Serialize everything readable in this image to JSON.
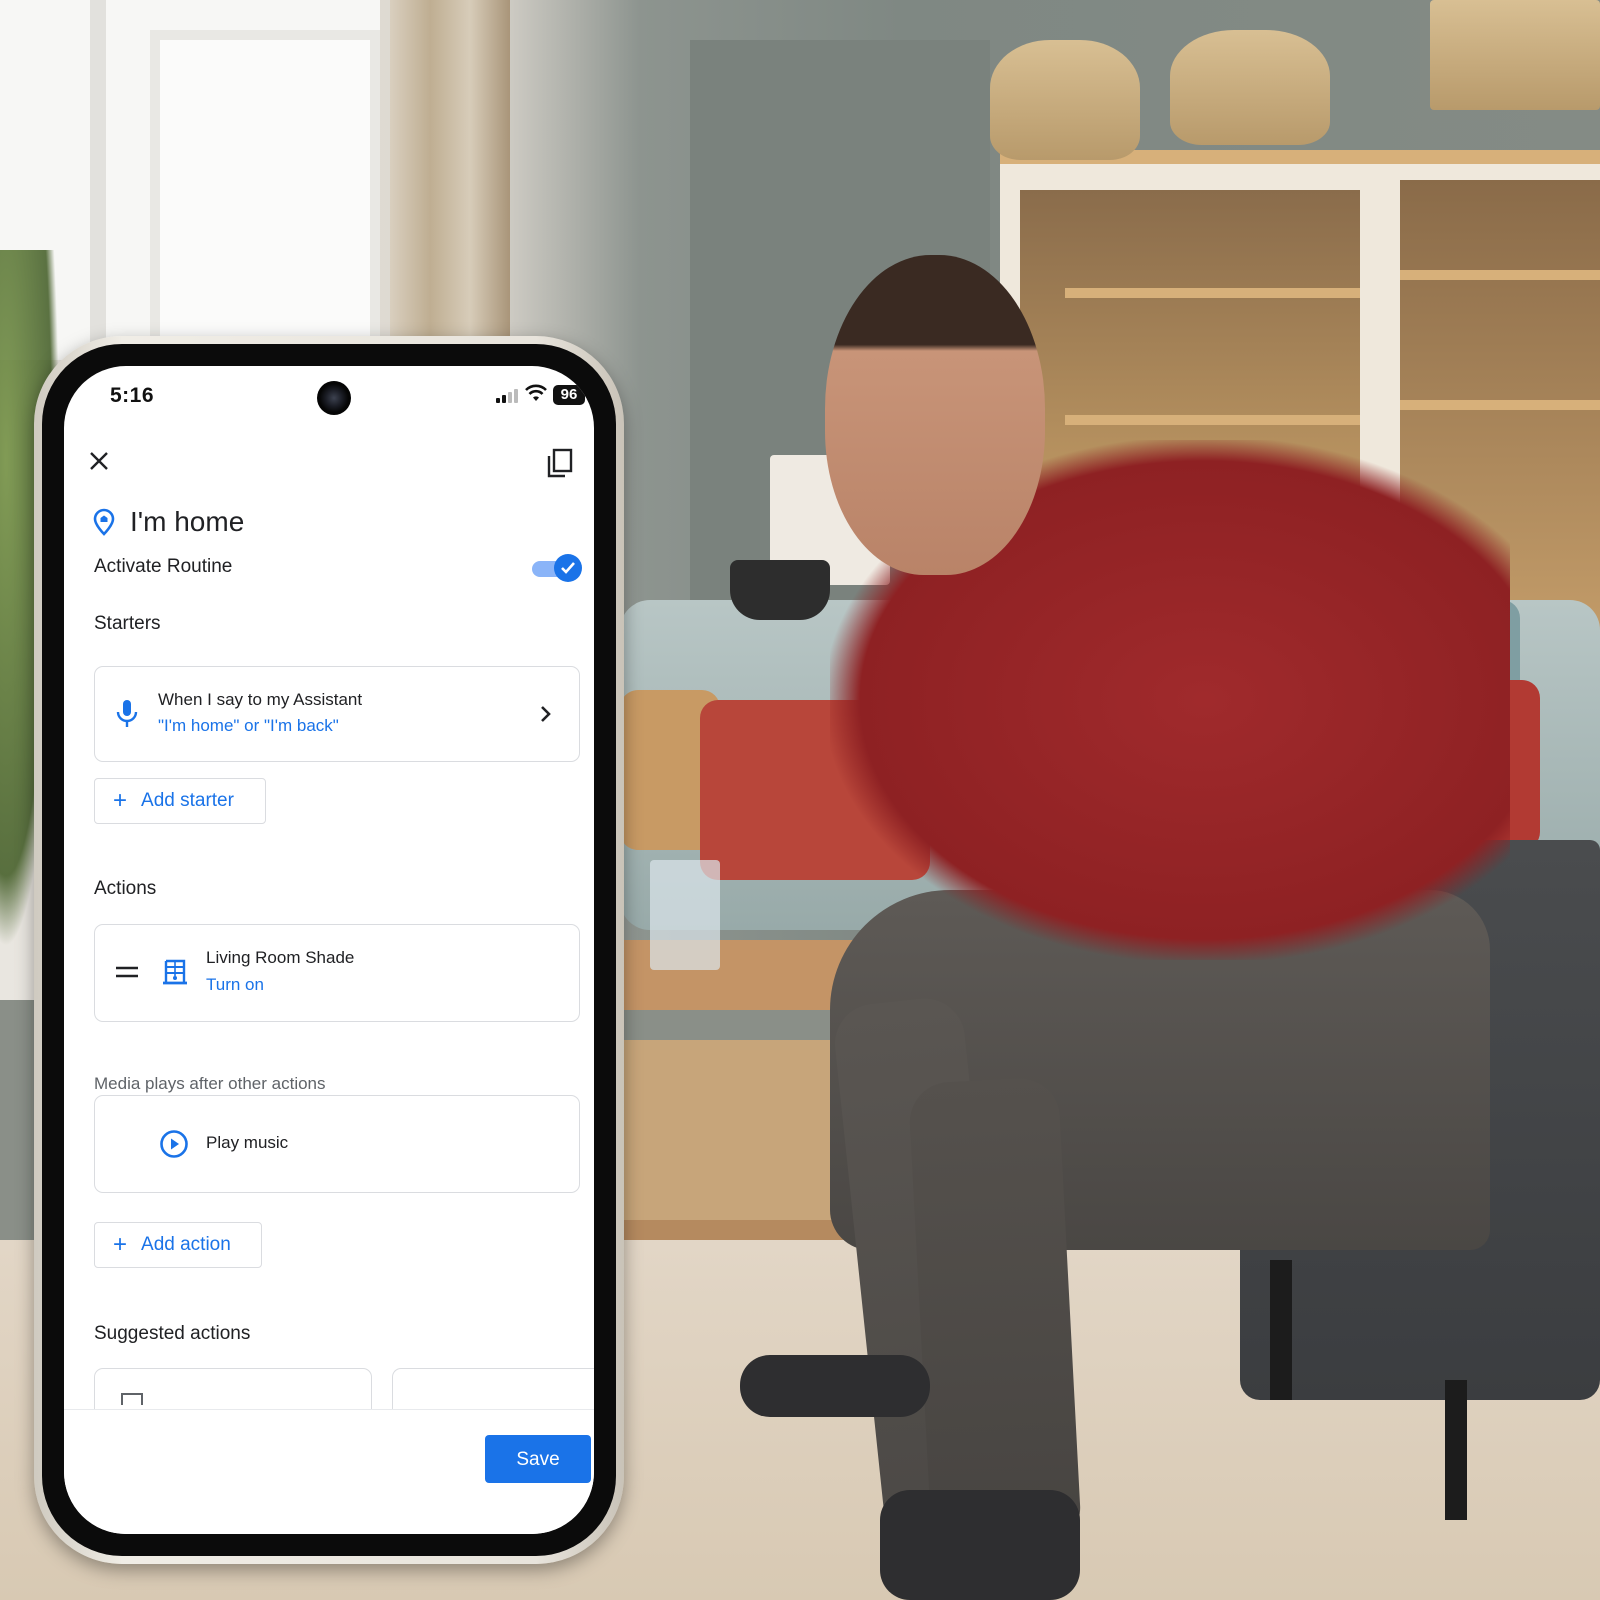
{
  "status_bar": {
    "time": "5:16",
    "battery": "96",
    "signal_icon": "signal-bars-icon",
    "wifi_icon": "wifi-icon"
  },
  "header": {
    "close_icon": "close-icon",
    "copy_icon": "copy-icon",
    "title_icon": "home-location-pin-icon",
    "title": "I'm home"
  },
  "activate": {
    "label": "Activate Routine",
    "enabled": true
  },
  "starters": {
    "heading": "Starters",
    "items": [
      {
        "icon": "microphone-icon",
        "title": "When I say to my Assistant",
        "subtitle": "\"I'm home\" or \"I'm back\""
      }
    ],
    "add_label": "Add starter"
  },
  "actions": {
    "heading": "Actions",
    "items": [
      {
        "icon": "window-shade-icon",
        "title": "Living Room Shade",
        "subtitle": "Turn on"
      }
    ],
    "media_helper": "Media plays after other actions",
    "media_item": {
      "icon": "play-circle-icon",
      "title": "Play music"
    },
    "add_label": "Add action"
  },
  "suggested": {
    "heading": "Suggested actions"
  },
  "footer": {
    "save_label": "Save"
  },
  "colors": {
    "accent": "#1a73e8",
    "accent_light": "#8ab4f8",
    "text_primary": "#202124",
    "text_secondary": "#5f6368",
    "border": "#dadce0"
  }
}
